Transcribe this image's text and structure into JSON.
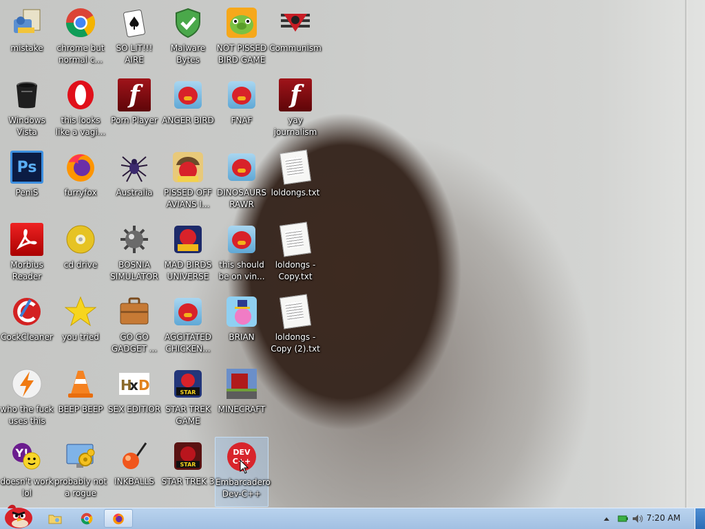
{
  "desktop": {
    "icons": [
      {
        "label": "mistake",
        "icon": "installer-icon"
      },
      {
        "label": "chrome but normal c...",
        "icon": "chrome-icon"
      },
      {
        "label": "SO LIT!!! AIRE",
        "icon": "solitaire-icon"
      },
      {
        "label": "Malware Bytes",
        "icon": "shield-icon"
      },
      {
        "label": "NOT PISSED BIRD GAME",
        "icon": "bad-piggies-icon"
      },
      {
        "label": "Communism",
        "icon": "emblem-icon"
      },
      {
        "label": "Windows Vista",
        "icon": "recycle-bin-icon"
      },
      {
        "label": "this looks like a vagi...",
        "icon": "opera-icon"
      },
      {
        "label": "Porn Player",
        "icon": "flash-icon"
      },
      {
        "label": "ANGER BIRD",
        "icon": "angry-birds-icon"
      },
      {
        "label": "FNAF",
        "icon": "angry-birds-icon"
      },
      {
        "label": "yay journalism",
        "icon": "flash-icon"
      },
      {
        "label": "PeniS",
        "icon": "photoshop-icon"
      },
      {
        "label": "furryfox",
        "icon": "firefox-icon"
      },
      {
        "label": "Australia",
        "icon": "spider-solitaire-icon"
      },
      {
        "label": "PISSED OFF AVIANS I...",
        "icon": "angry-birds-seasons-icon"
      },
      {
        "label": "DINOSAURS RAWR",
        "icon": "angry-birds-icon"
      },
      {
        "label": "loldongs.txt",
        "icon": "text-file-icon"
      },
      {
        "label": "Morbius Reader",
        "icon": "pdf-reader-icon"
      },
      {
        "label": "cd drive",
        "icon": "cd-icon"
      },
      {
        "label": "BOSNIA SIMULATOR",
        "icon": "mine-icon"
      },
      {
        "label": "MAD BIRDS UNIVERSE",
        "icon": "angry-birds-space-icon"
      },
      {
        "label": "this should be on vin...",
        "icon": "angry-birds-icon"
      },
      {
        "label": "loldongs - Copy.txt",
        "icon": "text-file-icon"
      },
      {
        "label": "CockCleaner",
        "icon": "ccleaner-icon"
      },
      {
        "label": "you tried",
        "icon": "star-icon"
      },
      {
        "label": "GO GO GADGET ...",
        "icon": "briefcase-icon"
      },
      {
        "label": "AGGITATED CHICKEN...",
        "icon": "angry-birds-icon"
      },
      {
        "label": "BRIAN",
        "icon": "angry-birds-stella-icon"
      },
      {
        "label": "loldongs - Copy (2).txt",
        "icon": "text-file-icon"
      },
      {
        "label": "who the fuck uses this",
        "icon": "winamp-icon"
      },
      {
        "label": "BEEP BEEP",
        "icon": "vlc-icon"
      },
      {
        "label": "SEX EDITIOR",
        "icon": "hxd-icon"
      },
      {
        "label": "STAR TREK GAME",
        "icon": "angry-birds-star-wars-icon"
      },
      {
        "label": "MINECRAFT",
        "icon": "minecraft-icon"
      },
      {
        "label": "",
        "icon": ""
      },
      {
        "label": "doesn't work lol",
        "icon": "yahoo-messenger-icon"
      },
      {
        "label": "probably not a rogue",
        "icon": "system-settings-icon"
      },
      {
        "label": "INKBALLS",
        "icon": "inkball-icon"
      },
      {
        "label": "STAR TREK 3",
        "icon": "angry-birds-star-wars-icon"
      },
      {
        "label": "Embarcadero Dev-C++",
        "icon": "dev-cpp-icon",
        "selected": true
      },
      {
        "label": "",
        "icon": ""
      }
    ]
  },
  "taskbar": {
    "start_icon": "angry-bird-start-icon",
    "pinned": [
      {
        "name": "explorer",
        "icon": "folder-icon"
      },
      {
        "name": "chrome",
        "icon": "chrome-icon"
      },
      {
        "name": "firefox",
        "icon": "firefox-icon",
        "active": true
      }
    ],
    "tray_icons": [
      "show-hidden-icon",
      "battery-icon",
      "volume-icon"
    ],
    "clock": "7:20 AM"
  }
}
